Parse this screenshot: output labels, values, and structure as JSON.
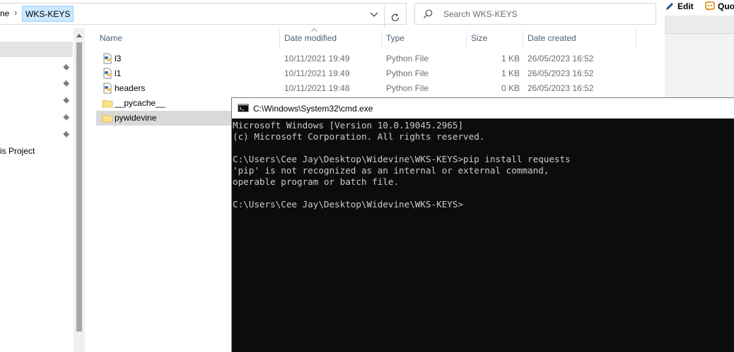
{
  "explorer": {
    "breadcrumb": {
      "previous": "ne",
      "separator": "›",
      "current": "WKS-KEYS"
    },
    "search": {
      "placeholder": "Search WKS-KEYS"
    },
    "nav": {
      "visible_label": "is Project"
    },
    "columns": {
      "name": "Name",
      "date_modified": "Date modified",
      "type": "Type",
      "size": "Size",
      "date_created": "Date created"
    },
    "files": [
      {
        "name": "l3",
        "icon": "python-file-icon",
        "date_modified": "10/11/2021 19:49",
        "type": "Python File",
        "size": "1 KB",
        "date_created": "26/05/2023 16:52"
      },
      {
        "name": "l1",
        "icon": "python-file-icon",
        "date_modified": "10/11/2021 19:49",
        "type": "Python File",
        "size": "1 KB",
        "date_created": "26/05/2023 16:52"
      },
      {
        "name": "headers",
        "icon": "python-file-icon",
        "date_modified": "10/11/2021 19:48",
        "type": "Python File",
        "size": "0 KB",
        "date_created": "26/05/2023 16:52"
      },
      {
        "name": "__pycache__",
        "icon": "folder-icon"
      },
      {
        "name": "pywidevine",
        "icon": "folder-icon"
      }
    ]
  },
  "right_app": {
    "edit_label": "Edit",
    "quote_label": "Quo"
  },
  "cmd": {
    "title": "C:\\Windows\\System32\\cmd.exe",
    "lines": [
      "Microsoft Windows [Version 10.0.19045.2965]",
      "(c) Microsoft Corporation. All rights reserved.",
      "",
      "C:\\Users\\Cee Jay\\Desktop\\Widevine\\WKS-KEYS>pip install requests",
      "'pip' is not recognized as an internal or external command,",
      "operable program or batch file.",
      "",
      "C:\\Users\\Cee Jay\\Desktop\\Widevine\\WKS-KEYS>"
    ]
  },
  "colors": {
    "selection": "#cce8ff",
    "console_bg": "#0c0c0c",
    "console_text": "#cccccc",
    "header_text": "#4c607a"
  }
}
